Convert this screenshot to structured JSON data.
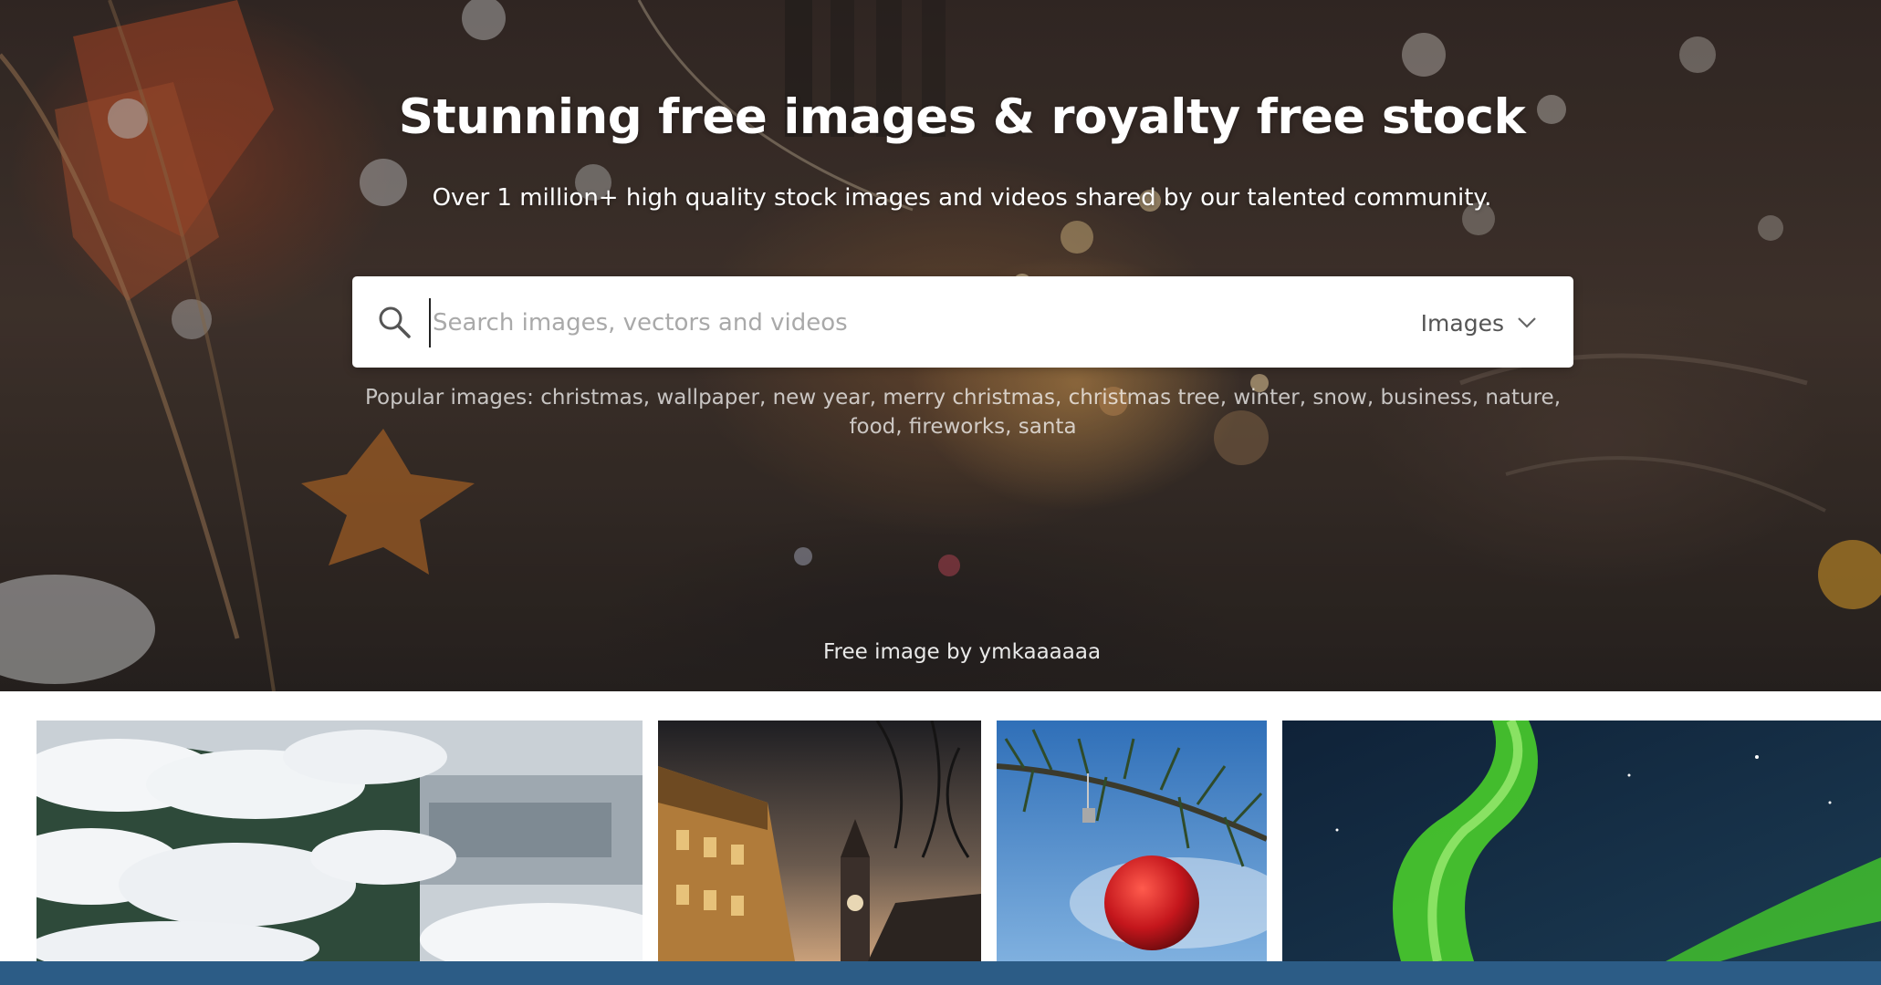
{
  "hero": {
    "title": "Stunning free images & royalty free stock",
    "subtitle": "Over 1 million+ high quality stock images and videos shared by our talented community."
  },
  "search": {
    "placeholder": "Search images, vectors and videos",
    "value": "",
    "icon": "search-icon",
    "type_selected": "Images",
    "type_icon": "chevron-down-icon"
  },
  "popular": {
    "label": "Popular images:",
    "tags": [
      "christmas",
      "wallpaper",
      "new year",
      "merry christmas",
      "christmas tree",
      "winter",
      "snow",
      "business",
      "nature",
      "food",
      "fireworks",
      "santa"
    ]
  },
  "credit": {
    "prefix": "Free image by",
    "author": "ymkaaaaaa"
  },
  "gallery": {
    "items": [
      {
        "subject": "snowy fir branches"
      },
      {
        "subject": "old town street at dusk with clock tower"
      },
      {
        "subject": "red christmas bauble on a fir branch"
      },
      {
        "subject": "green aurora borealis"
      }
    ]
  },
  "colors": {
    "bottom_bar": "#2c5c86",
    "text_white": "#ffffff"
  }
}
